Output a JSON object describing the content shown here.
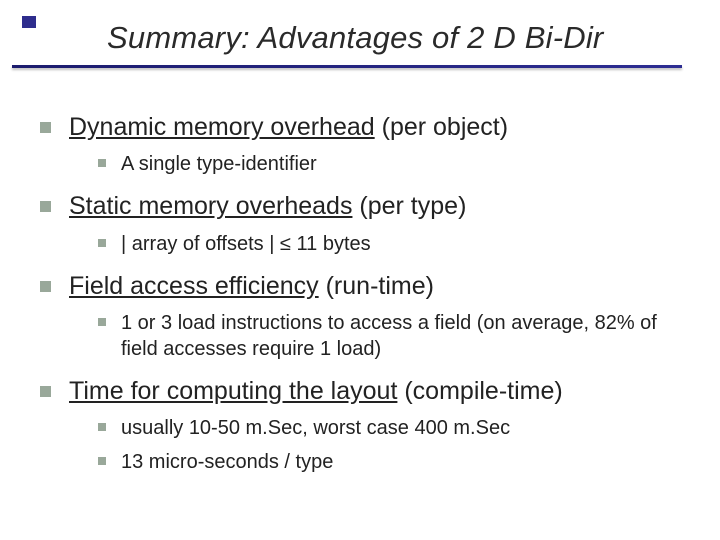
{
  "title": "Summary: Advantages of 2 D Bi-Dir",
  "items": [
    {
      "heading": "Dynamic memory overhead",
      "suffix": "(per object)",
      "subs": [
        "A single type-identifier"
      ]
    },
    {
      "heading": "Static memory overheads",
      "suffix": "(per type)",
      "subs": [
        "| array of offsets | ≤ 11 bytes"
      ]
    },
    {
      "heading": "Field access efficiency",
      "suffix": "(run-time)",
      "subs": [
        "1 or 3 load instructions to access a field (on average, 82% of field accesses require 1 load)"
      ]
    },
    {
      "heading": "Time for computing the layout",
      "suffix": "(compile-time)",
      "subs": [
        "usually 10-50 m.Sec, worst case 400 m.Sec",
        "13 micro-seconds / type"
      ]
    }
  ]
}
